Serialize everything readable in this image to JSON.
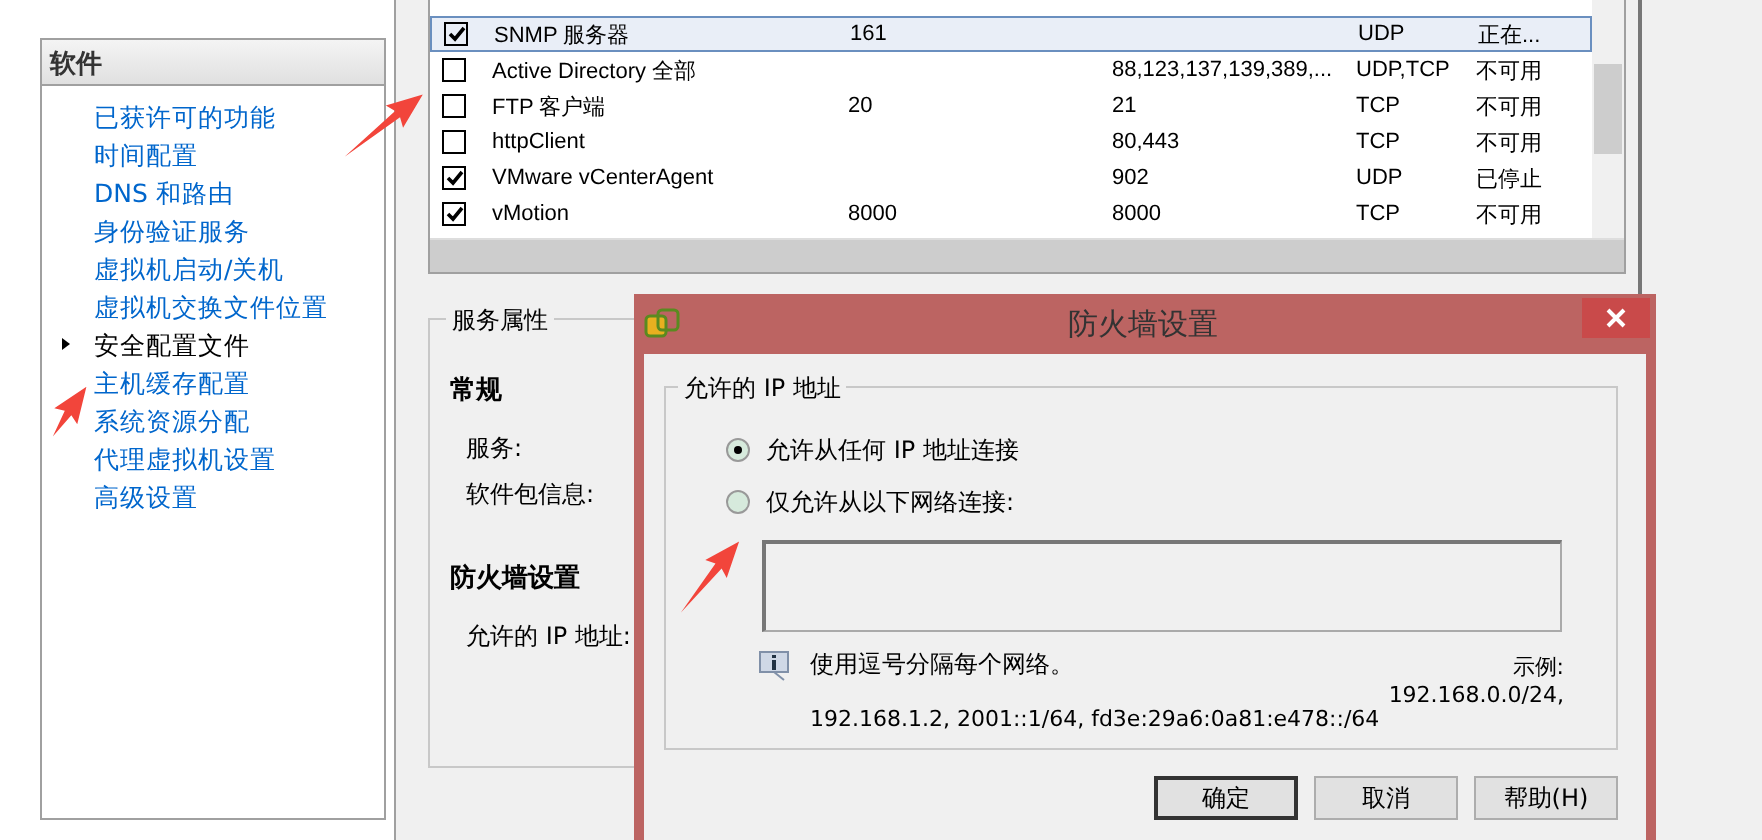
{
  "sidebar": {
    "header": "软件",
    "items": [
      {
        "label": "已获许可的功能",
        "selected": false
      },
      {
        "label": "时间配置",
        "selected": false
      },
      {
        "label": "DNS 和路由",
        "selected": false
      },
      {
        "label": "身份验证服务",
        "selected": false
      },
      {
        "label": "虚拟机启动/关机",
        "selected": false
      },
      {
        "label": "虚拟机交换文件位置",
        "selected": false
      },
      {
        "label": "安全配置文件",
        "selected": true
      },
      {
        "label": "主机缓存配置",
        "selected": false
      },
      {
        "label": "系统资源分配",
        "selected": false
      },
      {
        "label": "代理虚拟机设置",
        "selected": false
      },
      {
        "label": "高级设置",
        "selected": false
      }
    ]
  },
  "services_table": {
    "rows": [
      {
        "checked": true,
        "selected": true,
        "cells": [
          "SNMP 服务器",
          "161",
          "",
          "UDP",
          "正在..."
        ]
      },
      {
        "checked": false,
        "selected": false,
        "cells": [
          "Active Directory 全部",
          "",
          "88,123,137,139,389,...",
          "UDP,TCP",
          "不可用"
        ]
      },
      {
        "checked": false,
        "selected": false,
        "cells": [
          "FTP 客户端",
          "20",
          "21",
          "TCP",
          "不可用"
        ]
      },
      {
        "checked": false,
        "selected": false,
        "cells": [
          "httpClient",
          "",
          "80,443",
          "TCP",
          "不可用"
        ]
      },
      {
        "checked": true,
        "selected": false,
        "cells": [
          "VMware vCenterAgent",
          "",
          "902",
          "UDP",
          "已停止"
        ]
      },
      {
        "checked": true,
        "selected": false,
        "cells": [
          "vMotion",
          "8000",
          "8000",
          "TCP",
          "不可用"
        ]
      }
    ]
  },
  "service_properties": {
    "title": "服务属性",
    "sections": [
      {
        "heading": "常规",
        "fields": [
          "服务:",
          "软件包信息:"
        ]
      },
      {
        "heading": "防火墙设置",
        "fields": [
          "允许的 IP 地址:"
        ]
      }
    ]
  },
  "dialog": {
    "title": "防火墙设置",
    "group_title": "允许的 IP 地址",
    "options": [
      {
        "label": "允许从任何 IP 地址连接",
        "selected": true
      },
      {
        "label": "仅允许从以下网络连接:",
        "selected": false
      }
    ],
    "hint": "使用逗号分隔每个网络。",
    "example_label": "示例:",
    "example_first": "192.168.0.0/24,",
    "example_rest": "192.168.1.2, 2001::1/64, fd3e:29a6:0a81:e478::/64",
    "buttons": [
      {
        "label": "确定",
        "default": true
      },
      {
        "label": "取消",
        "default": false
      },
      {
        "label": "帮助(H)",
        "default": false
      }
    ]
  }
}
